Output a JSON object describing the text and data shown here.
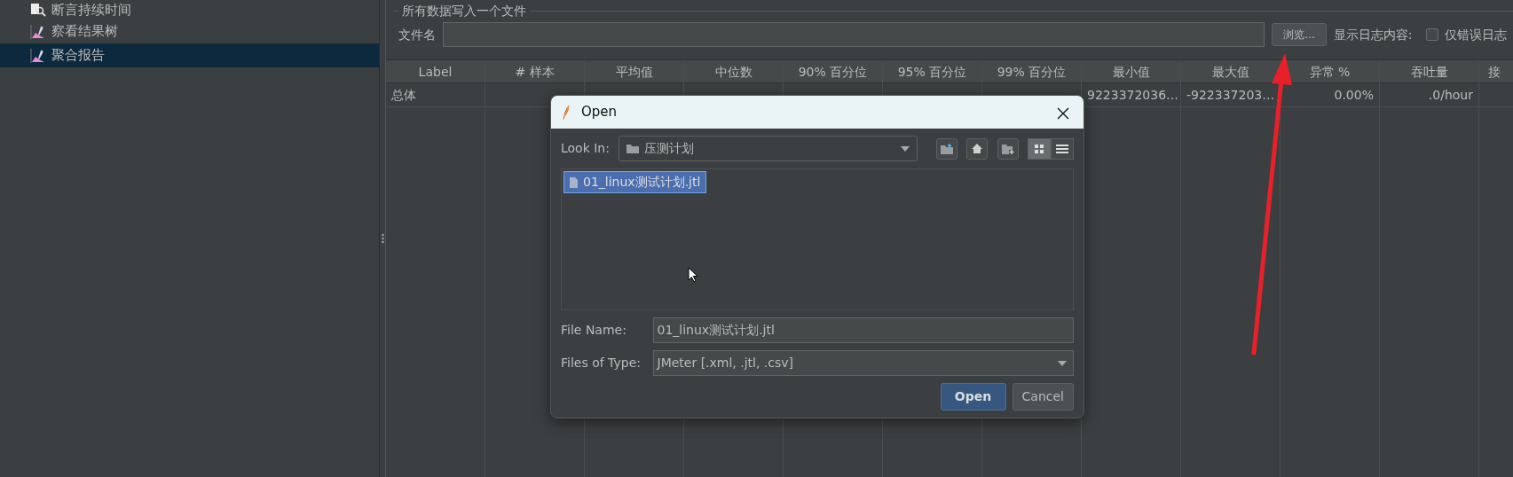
{
  "sidebar": {
    "items": [
      {
        "label": "断言持续时间",
        "kind": "assertion",
        "selected": false
      },
      {
        "label": "察看结果树",
        "kind": "listener",
        "selected": false
      },
      {
        "label": "聚合报告",
        "kind": "listener",
        "selected": true
      }
    ]
  },
  "file_panel": {
    "title": "所有数据写入一个文件",
    "filename_label": "文件名",
    "browse_button": "浏览...",
    "log_label": "显示日志内容:",
    "errors_only": {
      "label": "仅错误日志",
      "checked": false
    }
  },
  "table": {
    "columns": [
      "Label",
      "# 样本",
      "平均值",
      "中位数",
      "90% 百分位",
      "95% 百分位",
      "99% 百分位",
      "最小值",
      "最大值",
      "异常 %",
      "吞吐量",
      "接"
    ],
    "rows": [
      {
        "cells": [
          "总体",
          "",
          "",
          "",
          "",
          "",
          "",
          "9223372036…",
          "-922337203…",
          "0.00%",
          ".0/hour",
          ""
        ]
      }
    ]
  },
  "dialog": {
    "title": "Open",
    "look_in_label": "Look In:",
    "look_in_value": "压测计划",
    "view_buttons": [
      {
        "kind": "grid",
        "selected": true
      },
      {
        "kind": "list",
        "selected": false
      }
    ],
    "files": [
      {
        "name": "01_linux测试计划.jtl",
        "selected": true
      }
    ],
    "file_name_label": "File Name:",
    "file_name": "01_linux测试计划.jtl",
    "file_type_label": "Files of Type:",
    "file_type": "JMeter [.xml, .jtl, .csv]",
    "buttons": [
      {
        "label": "Open",
        "kind": "primary"
      },
      {
        "label": "Cancel",
        "kind": "secondary"
      }
    ]
  }
}
